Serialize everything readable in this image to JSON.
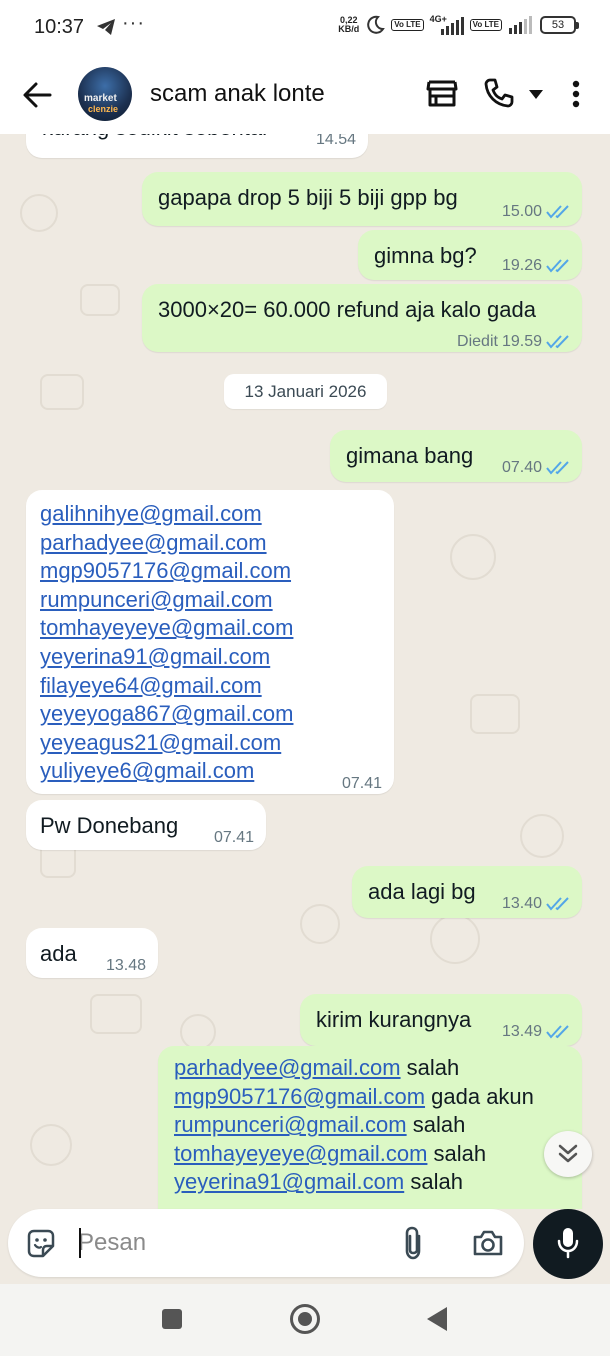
{
  "status_bar": {
    "time": "10:37",
    "more": "···",
    "speed_value": "0,22",
    "speed_unit": "KB/d",
    "network": "4G+",
    "volte_1": "Vo LTE",
    "volte_2": "Vo LTE",
    "battery": "53"
  },
  "header": {
    "contact_name": "scam anak lonte",
    "avatar_line1": "market",
    "avatar_line2": "clenzie"
  },
  "messages": [
    {
      "direction": "in",
      "text": "kurang sedikit sebentar",
      "time": "14.54"
    },
    {
      "direction": "out",
      "text": "gapapa drop 5 biji 5 biji gpp bg",
      "time": "15.00",
      "status": "read"
    },
    {
      "direction": "out",
      "text": "gimna bg?",
      "time": "19.26",
      "status": "read"
    },
    {
      "direction": "out",
      "text": "3000×20= 60.000 refund aja kalo gada",
      "edited_label": "Diedit",
      "time": "19.59",
      "status": "read"
    },
    {
      "direction": "out",
      "text": "gimana bang",
      "time": "07.40",
      "status": "read"
    },
    {
      "direction": "in",
      "emails": [
        "galihnihye@gmail.com",
        "parhadyee@gmail.com",
        "mgp9057176@gmail.com",
        "rumpunceri@gmail.com",
        "tomhayeyeye@gmail.com",
        "yeyerina91@gmail.com",
        "filayeye64@gmail.com",
        "yeyeyoga867@gmail.com",
        "yeyeagus21@gmail.com",
        "yuliyeye6@gmail.com"
      ],
      "time": "07.41"
    },
    {
      "direction": "in",
      "text": "Pw Donebang",
      "time": "07.41"
    },
    {
      "direction": "out",
      "text": "ada lagi bg",
      "time": "13.40",
      "status": "read"
    },
    {
      "direction": "in",
      "text": "ada",
      "time": "13.48"
    },
    {
      "direction": "out",
      "text": "kirim kurangnya",
      "time": "13.49",
      "status": "read"
    },
    {
      "direction": "out",
      "lines": [
        {
          "email": "parhadyee@gmail.com",
          "note": " salah"
        },
        {
          "email": "mgp9057176@gmail.com",
          "note": " gada akun"
        },
        {
          "email": "rumpunceri@gmail.com",
          "note": " salah"
        },
        {
          "email": "tomhayeyeye@gmail.com",
          "note": " salah"
        },
        {
          "email": "yeyerina91@gmail.com",
          "note": " salah"
        }
      ]
    }
  ],
  "date_separator": "13 Januari 2026",
  "composer": {
    "placeholder": "Pesan"
  },
  "colors": {
    "outgoing_bubble": "#dcf8c6",
    "incoming_bubble": "#ffffff",
    "read_tick": "#53a6e8",
    "link": "#2a5ebd",
    "chat_background": "#efeae2"
  }
}
